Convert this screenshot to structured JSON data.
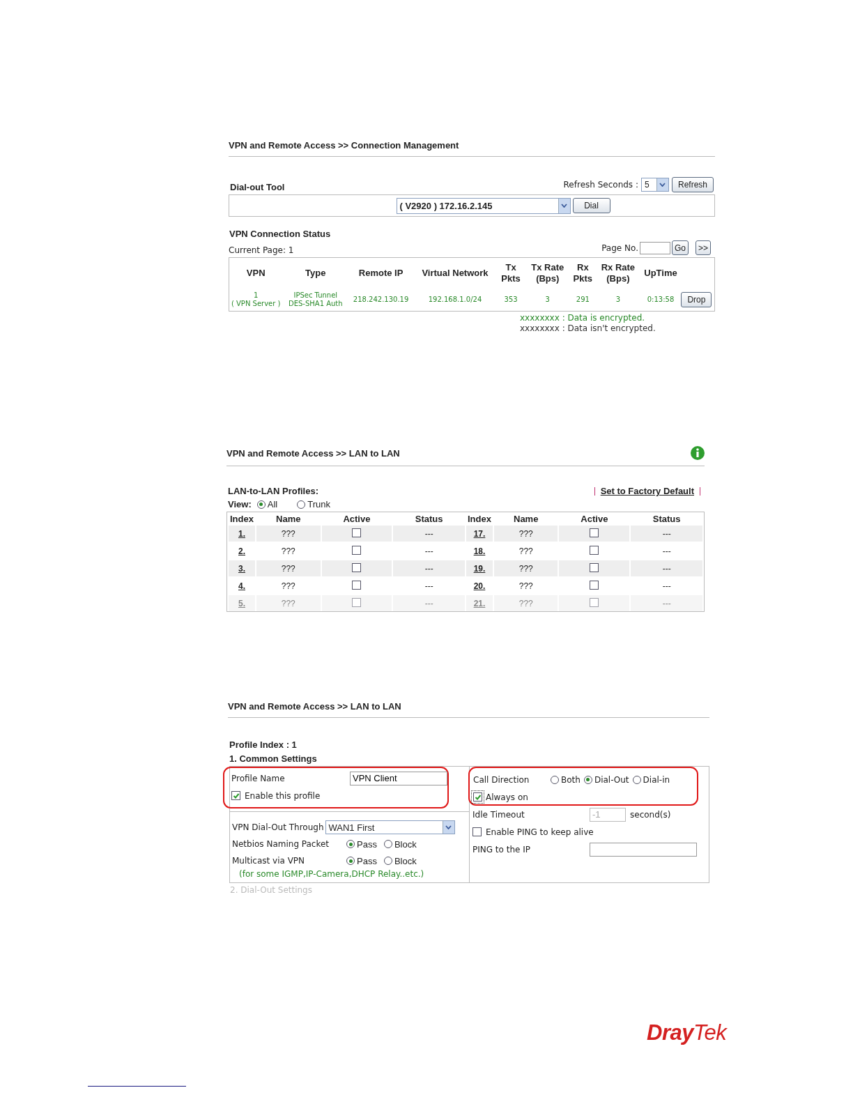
{
  "connection": {
    "title": "VPN and Remote Access >> Connection Management",
    "dial_tool": {
      "label": "Dial-out Tool",
      "refresh_label": "Refresh Seconds :",
      "refresh_value": "5",
      "refresh_button": "Refresh",
      "profile": "( V2920 ) 172.16.2.145",
      "dial_button": "Dial"
    },
    "status": {
      "title": "VPN Connection Status",
      "current_page": "Current Page: 1",
      "page_no_label": "Page No.",
      "go_button": "Go",
      "next_button": ">>",
      "columns": [
        "VPN",
        "Type",
        "Remote IP",
        "Virtual Network",
        "Tx Pkts",
        "Tx Rate (Bps)",
        "Rx Pkts",
        "Rx Rate (Bps)",
        "UpTime"
      ],
      "rows": [
        {
          "vpn": "1",
          "vpn_role": "( VPN Server )",
          "type": "IPSec Tunnel",
          "type_auth": "DES-SHA1 Auth",
          "remote_ip": "218.242.130.19",
          "virtual_network": "192.168.1.0/24",
          "tx_pkts": "353",
          "tx_rate": "3",
          "rx_pkts": "291",
          "rx_rate": "3",
          "uptime": "0:13:58",
          "action": "Drop",
          "encrypted": true
        }
      ]
    },
    "legend": [
      {
        "text": "xxxxxxxx : Data is encrypted.",
        "kind": "encrypted"
      },
      {
        "text": "xxxxxxxx : Data isn't encrypted.",
        "kind": "plain"
      }
    ]
  },
  "lan": {
    "title": "VPN and Remote Access >> LAN to LAN",
    "profiles_label": "LAN-to-LAN Profiles:",
    "factory_link": "Set to Factory Default",
    "view_label": "View:",
    "view_options": [
      {
        "label": "All",
        "selected": true
      },
      {
        "label": "Trunk",
        "selected": false
      }
    ],
    "columns": [
      "Index",
      "Name",
      "Active",
      "Status",
      "Index",
      "Name",
      "Active",
      "Status"
    ],
    "rows": [
      {
        "left": {
          "index": "1.",
          "name": "???",
          "active": false,
          "status": "---"
        },
        "right": {
          "index": "17.",
          "name": "???",
          "active": false,
          "status": "---"
        }
      },
      {
        "left": {
          "index": "2.",
          "name": "???",
          "active": false,
          "status": "---"
        },
        "right": {
          "index": "18.",
          "name": "???",
          "active": false,
          "status": "---"
        }
      },
      {
        "left": {
          "index": "3.",
          "name": "???",
          "active": false,
          "status": "---"
        },
        "right": {
          "index": "19.",
          "name": "???",
          "active": false,
          "status": "---"
        }
      },
      {
        "left": {
          "index": "4.",
          "name": "???",
          "active": false,
          "status": "---"
        },
        "right": {
          "index": "20.",
          "name": "???",
          "active": false,
          "status": "---"
        }
      },
      {
        "left": {
          "index": "5.",
          "name": "???",
          "active": false,
          "status": "---"
        },
        "right": {
          "index": "21.",
          "name": "???",
          "active": false,
          "status": "---"
        }
      }
    ]
  },
  "profile": {
    "title": "VPN and Remote Access >> LAN to LAN",
    "profile_index": "Profile Index : 1",
    "section": "1. Common Settings",
    "profile_name_label": "Profile Name",
    "profile_name_value": "VPN Client",
    "enable_label": "Enable this profile",
    "enable_checked": true,
    "dialout_label": "VPN Dial-Out Through",
    "dialout_value": "WAN1 First",
    "netbios_label": "Netbios Naming Packet",
    "netbios_options": [
      {
        "label": "Pass",
        "selected": true
      },
      {
        "label": "Block",
        "selected": false
      }
    ],
    "multicast_label": "Multicast via VPN",
    "multicast_options": [
      {
        "label": "Pass",
        "selected": true
      },
      {
        "label": "Block",
        "selected": false
      }
    ],
    "note": "(for some IGMP,IP-Camera,DHCP Relay..etc.)",
    "call_direction_label": "Call Direction",
    "call_options": [
      {
        "label": "Both",
        "selected": false
      },
      {
        "label": "Dial-Out",
        "selected": true
      },
      {
        "label": "Dial-in",
        "selected": false
      }
    ],
    "always_on_label": "Always on",
    "always_on_checked": true,
    "idle_timeout_label": "Idle Timeout",
    "idle_timeout_value": "-1",
    "idle_unit": "second(s)",
    "ping_label": "Enable PING to keep alive",
    "ping_checked": false,
    "ping_ip_label": "PING to the IP",
    "next_section": "2. Dial-Out Settings"
  },
  "logo": "**Dray**Tek"
}
